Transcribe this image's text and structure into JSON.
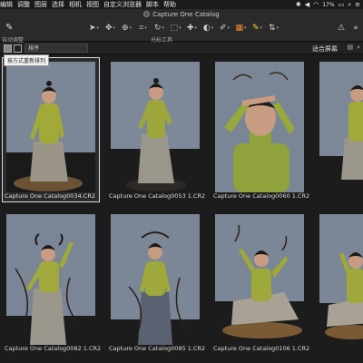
{
  "menubar": {
    "items": [
      "编辑",
      "调整",
      "图层",
      "选择",
      "相机",
      "视图",
      "自定义浏览器",
      "脚本",
      "帮助"
    ],
    "battery": "17%",
    "icons": [
      "bluetooth-icon",
      "volume-icon",
      "wifi-icon",
      "battery-icon",
      "search-icon",
      "control-center-icon"
    ]
  },
  "window": {
    "title": "Capture One Catalog"
  },
  "toolbar": {
    "left_tool_label": "自动调整",
    "cursor_tools_label": "光标工具",
    "accent_color": "#ff8a2a"
  },
  "subbar": {
    "sort_label": "排序",
    "fit_label": "适合屏幕"
  },
  "tooltip": {
    "text": "按方式重新排列"
  },
  "thumbnails": [
    {
      "filename": "Capture One Catalog0034.CR2",
      "selected": true
    },
    {
      "filename": "Capture One Catalog0053 1.CR2",
      "selected": false
    },
    {
      "filename": "Capture One Catalog0060 1.CR2",
      "selected": false
    },
    {
      "filename": "",
      "selected": false
    },
    {
      "filename": "Capture One Catalog0082 1.CR2",
      "selected": false
    },
    {
      "filename": "Capture One Catalog0085 1.CR2",
      "selected": false
    },
    {
      "filename": "Capture One Catalog0106 1.CR2",
      "selected": false
    },
    {
      "filename": "",
      "selected": false
    }
  ]
}
